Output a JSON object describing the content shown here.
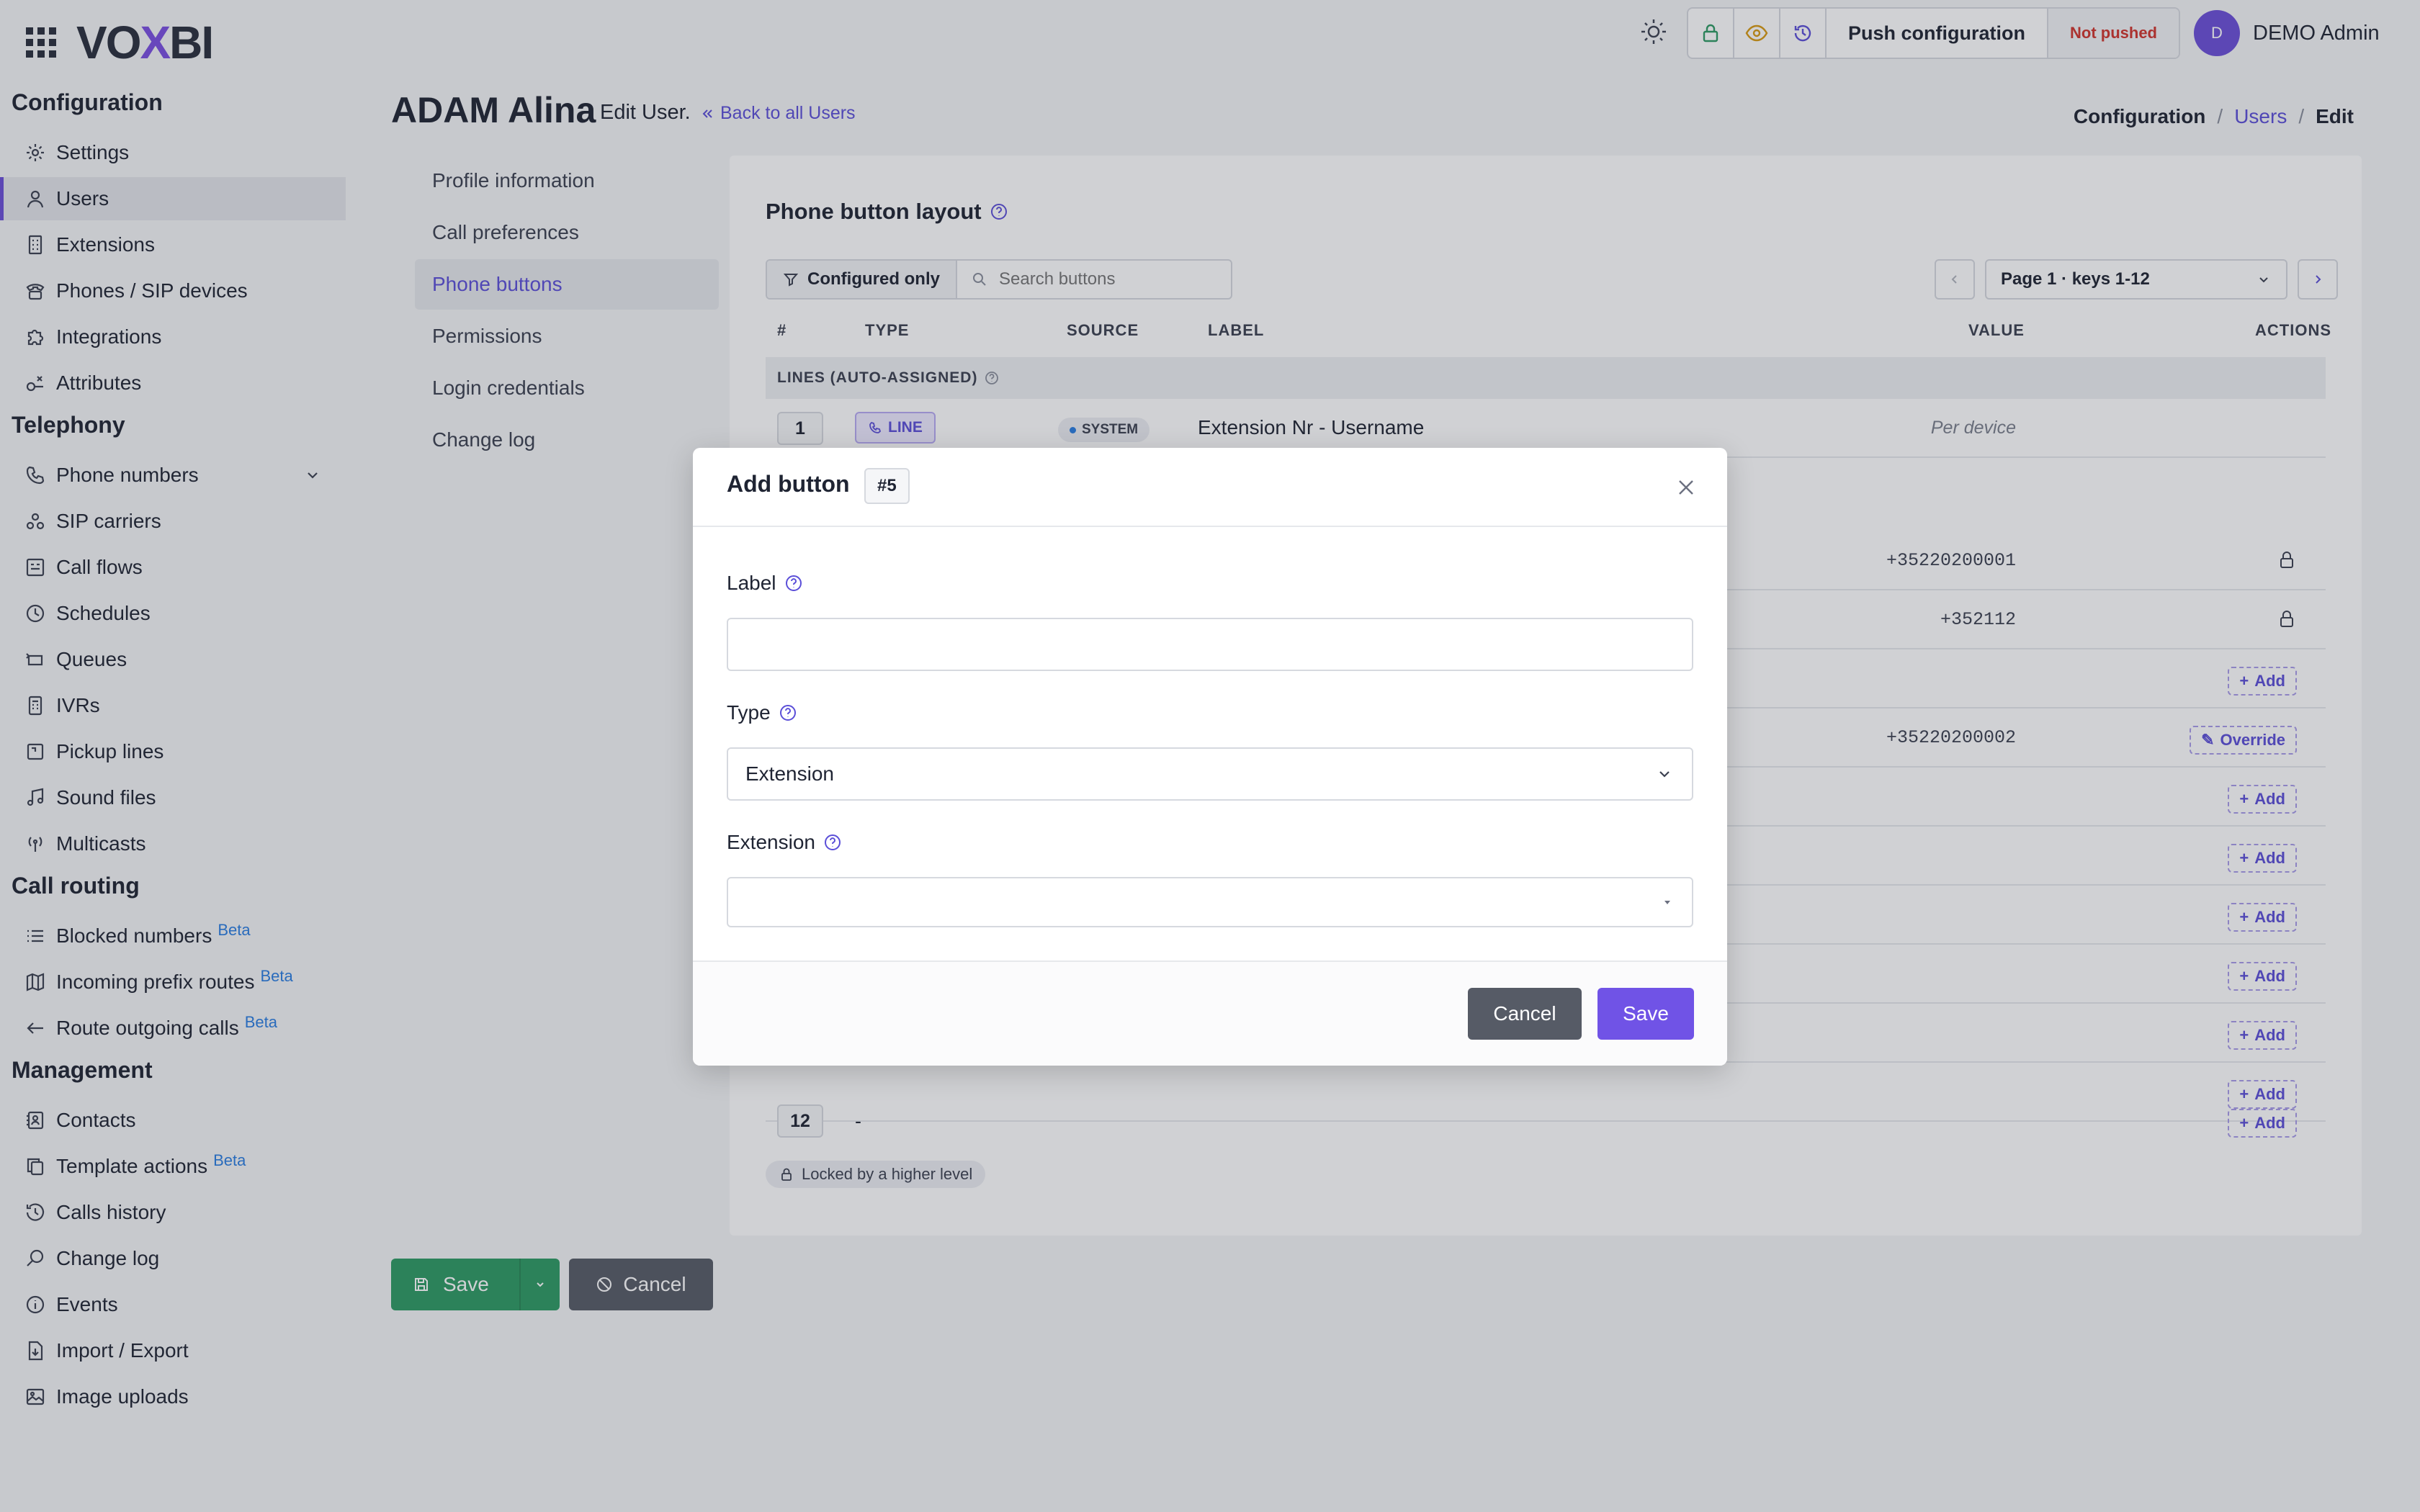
{
  "app": {
    "logo": "VOXBI"
  },
  "topbar": {
    "push_label": "Push configuration",
    "status_label": "Not pushed",
    "status_color": "#d0342c",
    "user_initial": "D",
    "user_name": "DEMO Admin",
    "icons": [
      "apps-grid-icon",
      "sun-icon",
      "lock-icon",
      "eye-icon",
      "history-icon"
    ]
  },
  "sidebar": {
    "sections": [
      {
        "title": "Configuration",
        "items": [
          {
            "label": "Settings",
            "icon": "gear-icon"
          },
          {
            "label": "Users",
            "icon": "user-icon",
            "active": true
          },
          {
            "label": "Extensions",
            "icon": "extensions-icon"
          },
          {
            "label": "Phones / SIP devices",
            "icon": "phone-device-icon"
          },
          {
            "label": "Integrations",
            "icon": "puzzle-icon"
          },
          {
            "label": "Attributes",
            "icon": "attributes-icon"
          }
        ]
      },
      {
        "title": "Telephony",
        "items": [
          {
            "label": "Phone numbers",
            "icon": "phone-icon"
          },
          {
            "label": "SIP carriers",
            "icon": "carrier-icon"
          },
          {
            "label": "Call flows",
            "icon": "call-flow-icon"
          },
          {
            "label": "Schedules",
            "icon": "clock-icon"
          },
          {
            "label": "Queues",
            "icon": "queue-icon"
          },
          {
            "label": "IVRs",
            "icon": "ivr-icon"
          },
          {
            "label": "Pickup lines",
            "icon": "pickup-icon"
          },
          {
            "label": "Sound files",
            "icon": "music-icon"
          },
          {
            "label": "Multicasts",
            "icon": "broadcast-icon"
          }
        ]
      },
      {
        "title": "Call routing",
        "items": [
          {
            "label": "Blocked numbers",
            "icon": "list-icon",
            "beta": "Beta"
          },
          {
            "label": "Incoming prefix routes",
            "icon": "map-icon",
            "beta": "Beta"
          },
          {
            "label": "Route outgoing calls",
            "icon": "arrow-left-icon",
            "beta": "Beta"
          }
        ]
      },
      {
        "title": "Management",
        "items": [
          {
            "label": "Contacts",
            "icon": "contacts-icon"
          },
          {
            "label": "Template actions",
            "icon": "copy-icon",
            "beta": "Beta"
          },
          {
            "label": "Calls history",
            "icon": "history-icon"
          },
          {
            "label": "Change log",
            "icon": "search-icon"
          },
          {
            "label": "Events",
            "icon": "info-icon"
          },
          {
            "label": "Import / Export",
            "icon": "import-icon"
          },
          {
            "label": "Image uploads",
            "icon": "image-icon"
          }
        ]
      }
    ]
  },
  "page": {
    "title": "ADAM Alina",
    "subtitle": "Edit User.",
    "back_link": "Back to all Users",
    "breadcrumb": [
      "Configuration",
      "Users",
      "Edit"
    ]
  },
  "subnav": [
    {
      "label": "Profile information"
    },
    {
      "label": "Call preferences"
    },
    {
      "label": "Phone buttons",
      "active": true
    },
    {
      "label": "Permissions"
    },
    {
      "label": "Login credentials"
    },
    {
      "label": "Change log"
    }
  ],
  "panel": {
    "title": "Phone button layout",
    "filter_label": "Configured only",
    "search_placeholder": "Search buttons",
    "page_select": "Page 1 · keys 1-12",
    "columns": [
      "#",
      "TYPE",
      "SOURCE",
      "LABEL",
      "VALUE",
      "ACTIONS"
    ],
    "group_lines": "LINES (AUTO-ASSIGNED)",
    "row1": {
      "num": "1",
      "type": "LINE",
      "source": "SYSTEM",
      "label": "Extension Nr - Username",
      "value": "Per device"
    },
    "values": [
      "+35220200001",
      "+352112",
      "+35220200002"
    ],
    "add_label": "Add",
    "override_label": "Override",
    "row12": {
      "num": "12",
      "dash": "-"
    },
    "locked_note": "Locked by a higher level"
  },
  "footer": {
    "save_label": "Save",
    "cancel_label": "Cancel"
  },
  "modal": {
    "title": "Add button",
    "badge": "#5",
    "label_field": "Label",
    "label_value": "",
    "type_field": "Type",
    "type_value": "Extension",
    "extension_field": "Extension",
    "extension_value": "",
    "cancel_label": "Cancel",
    "save_label": "Save"
  }
}
